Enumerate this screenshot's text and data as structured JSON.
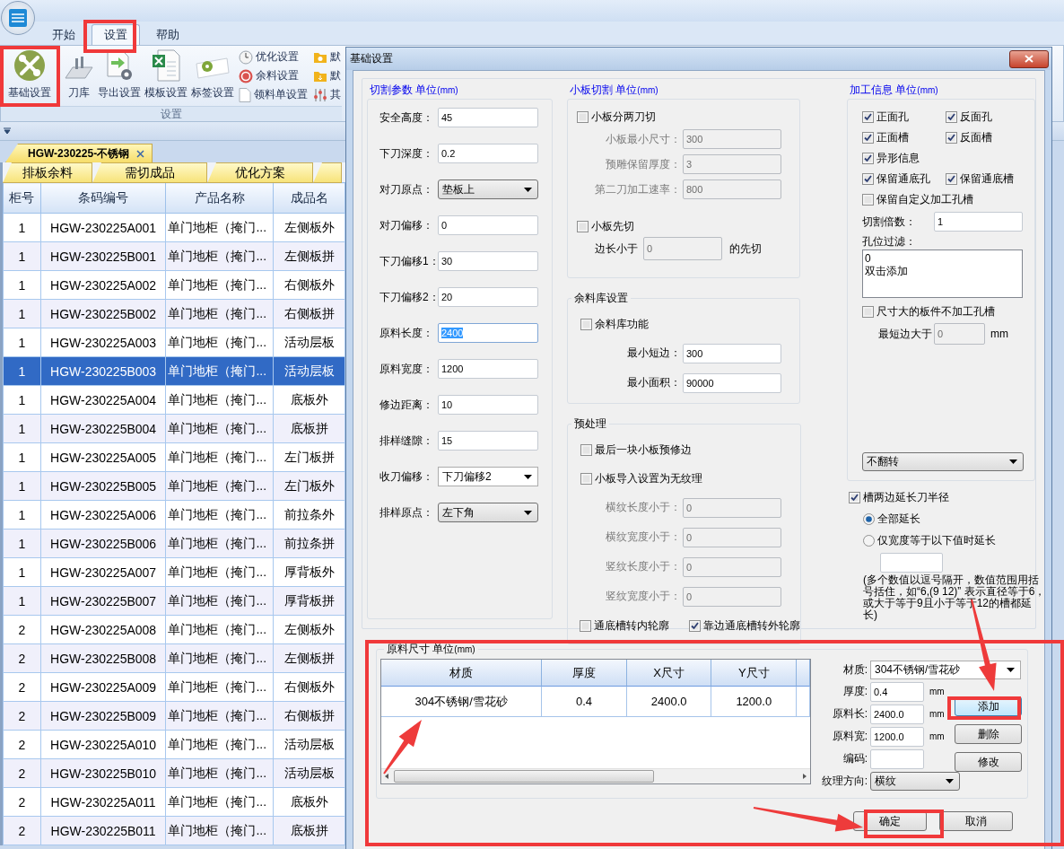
{
  "app": {
    "ribbon_tabs": [
      {
        "label": "开始",
        "selected": false
      },
      {
        "label": "设置",
        "selected": true
      },
      {
        "label": "帮助",
        "selected": false
      }
    ],
    "ribbon_large_buttons": [
      "基础设置",
      "刀库",
      "导出设置",
      "模板设置",
      "标签设置"
    ],
    "ribbon_small_buttons": [
      "优化设置",
      "余料设置",
      "领料单设置",
      "默",
      "默",
      "其"
    ],
    "ribbon_group_label": "设置",
    "document_tab": "HGW-230225-不锈钢",
    "sub_tabs": [
      "排板余料",
      "需切成品",
      "优化方案"
    ],
    "table": {
      "columns": [
        "柜号",
        "条码编号",
        "产品名称",
        "成品名"
      ],
      "rows": [
        {
          "cells": [
            "1",
            "HGW-230225A001",
            "单门地柜（掩门...",
            "左侧板外"
          ],
          "selected": false
        },
        {
          "cells": [
            "1",
            "HGW-230225B001",
            "单门地柜（掩门...",
            "左侧板拼"
          ],
          "selected": false
        },
        {
          "cells": [
            "1",
            "HGW-230225A002",
            "单门地柜（掩门...",
            "右侧板外"
          ],
          "selected": false
        },
        {
          "cells": [
            "1",
            "HGW-230225B002",
            "单门地柜（掩门...",
            "右侧板拼"
          ],
          "selected": false
        },
        {
          "cells": [
            "1",
            "HGW-230225A003",
            "单门地柜（掩门...",
            "活动层板"
          ],
          "selected": false
        },
        {
          "cells": [
            "1",
            "HGW-230225B003",
            "单门地柜（掩门...",
            "活动层板"
          ],
          "selected": true
        },
        {
          "cells": [
            "1",
            "HGW-230225A004",
            "单门地柜（掩门...",
            "底板外"
          ],
          "selected": false
        },
        {
          "cells": [
            "1",
            "HGW-230225B004",
            "单门地柜（掩门...",
            "底板拼"
          ],
          "selected": false
        },
        {
          "cells": [
            "1",
            "HGW-230225A005",
            "单门地柜（掩门...",
            "左门板拼"
          ],
          "selected": false
        },
        {
          "cells": [
            "1",
            "HGW-230225B005",
            "单门地柜（掩门...",
            "左门板外"
          ],
          "selected": false
        },
        {
          "cells": [
            "1",
            "HGW-230225A006",
            "单门地柜（掩门...",
            "前拉条外"
          ],
          "selected": false
        },
        {
          "cells": [
            "1",
            "HGW-230225B006",
            "单门地柜（掩门...",
            "前拉条拼"
          ],
          "selected": false
        },
        {
          "cells": [
            "1",
            "HGW-230225A007",
            "单门地柜（掩门...",
            "厚背板外"
          ],
          "selected": false
        },
        {
          "cells": [
            "1",
            "HGW-230225B007",
            "单门地柜（掩门...",
            "厚背板拼"
          ],
          "selected": false
        },
        {
          "cells": [
            "2",
            "HGW-230225A008",
            "单门地柜（掩门...",
            "左侧板外"
          ],
          "selected": false
        },
        {
          "cells": [
            "2",
            "HGW-230225B008",
            "单门地柜（掩门...",
            "左侧板拼"
          ],
          "selected": false
        },
        {
          "cells": [
            "2",
            "HGW-230225A009",
            "单门地柜（掩门...",
            "右侧板外"
          ],
          "selected": false
        },
        {
          "cells": [
            "2",
            "HGW-230225B009",
            "单门地柜（掩门...",
            "右侧板拼"
          ],
          "selected": false
        },
        {
          "cells": [
            "2",
            "HGW-230225A010",
            "单门地柜（掩门...",
            "活动层板"
          ],
          "selected": false
        },
        {
          "cells": [
            "2",
            "HGW-230225B010",
            "单门地柜（掩门...",
            "活动层板"
          ],
          "selected": false
        },
        {
          "cells": [
            "2",
            "HGW-230225A011",
            "单门地柜（掩门...",
            "底板外"
          ],
          "selected": false
        },
        {
          "cells": [
            "2",
            "HGW-230225B011",
            "单门地柜（掩门...",
            "底板拼"
          ],
          "selected": false
        }
      ]
    }
  },
  "dialog": {
    "title": "基础设置",
    "cutting": {
      "title": "切割参数 单位",
      "unit": "(mm)",
      "fields": [
        {
          "kind": "input",
          "label": "安全高度：",
          "value": "45",
          "focused": false
        },
        {
          "kind": "input",
          "label": "下刀深度：",
          "value": "0.2",
          "focused": false
        },
        {
          "kind": "select",
          "label": "对刀原点：",
          "value": "垫板上",
          "focused": false
        },
        {
          "kind": "input",
          "label": "对刀偏移：",
          "value": "0",
          "focused": false
        },
        {
          "kind": "input",
          "label": "下刀偏移1：",
          "value": "30",
          "focused": false
        },
        {
          "kind": "input",
          "label": "下刀偏移2：",
          "value": "20",
          "focused": false
        },
        {
          "kind": "input",
          "label": "原料长度：",
          "value": "2400",
          "focused": true
        },
        {
          "kind": "input",
          "label": "原料宽度：",
          "value": "1200",
          "focused": false
        },
        {
          "kind": "input",
          "label": "修边距离：",
          "value": "10",
          "focused": false
        },
        {
          "kind": "input",
          "label": "排样缝隙：",
          "value": "15",
          "focused": false
        },
        {
          "kind": "combo",
          "label": "收刀偏移：",
          "value": "下刀偏移2",
          "focused": false
        },
        {
          "kind": "select",
          "label": "排样原点：",
          "value": "左下角",
          "focused": false
        }
      ]
    },
    "small_cut": {
      "title": "小板切割 单位",
      "unit": "(mm)",
      "items": [
        {
          "kind": "checkbox",
          "label": "小板分两刀切",
          "checked": false
        },
        {
          "kind": "field",
          "label": "小板最小尺寸：",
          "value": "300",
          "disabled": true
        },
        {
          "kind": "field",
          "label": "预雕保留厚度：",
          "value": "3",
          "disabled": true
        },
        {
          "kind": "field",
          "label": "第二刀加工速率：",
          "value": "800",
          "disabled": true
        },
        {
          "kind": "checkbox",
          "label": "小板先切",
          "checked": false
        },
        {
          "kind": "inline",
          "label": "边长小于",
          "value": "0",
          "suffix": "的先切",
          "disabled": true
        }
      ]
    },
    "remnant": {
      "title": "余料库设置",
      "items": [
        {
          "kind": "checkbox",
          "label": "余料库功能",
          "checked": false
        },
        {
          "kind": "field",
          "label": "最小短边：",
          "value": "300",
          "disabled": false
        },
        {
          "kind": "field",
          "label": "最小面积：",
          "value": "90000",
          "disabled": false
        }
      ]
    },
    "preprocess": {
      "title": "预处理",
      "items": [
        {
          "kind": "checkbox",
          "label": "最后一块小板预修边",
          "checked": false
        },
        {
          "kind": "checkbox",
          "label": "小板导入设置为无纹理",
          "checked": false
        },
        {
          "kind": "field",
          "label": "横纹长度小于：",
          "value": "0",
          "disabled": true
        },
        {
          "kind": "field",
          "label": "横纹宽度小于：",
          "value": "0",
          "disabled": true
        },
        {
          "kind": "field",
          "label": "竖纹长度小于：",
          "value": "0",
          "disabled": true
        },
        {
          "kind": "field",
          "label": "竖纹宽度小于：",
          "value": "0",
          "disabled": true
        },
        {
          "kind": "pair",
          "items": [
            {
              "label": "通底槽转内轮廓",
              "checked": false
            },
            {
              "label": "靠边通底槽转外轮廓",
              "checked": true
            }
          ]
        }
      ]
    },
    "machining": {
      "title": "加工信息 单位",
      "unit": "(mm)",
      "items": [
        {
          "kind": "pair",
          "items": [
            {
              "label": "正面孔",
              "checked": true
            },
            {
              "label": "反面孔",
              "checked": true
            }
          ]
        },
        {
          "kind": "pair",
          "items": [
            {
              "label": "正面槽",
              "checked": true
            },
            {
              "label": "反面槽",
              "checked": true
            }
          ]
        },
        {
          "kind": "checkbox",
          "label": "异形信息",
          "checked": true
        },
        {
          "kind": "pair",
          "items": [
            {
              "label": "保留通底孔",
              "checked": true
            },
            {
              "label": "保留通底槽",
              "checked": true
            }
          ]
        },
        {
          "kind": "checkbox",
          "label": "保留自定义加工孔槽",
          "checked": false
        },
        {
          "kind": "field",
          "label": "切割倍数：",
          "value": "1",
          "disabled": false
        },
        {
          "kind": "label",
          "label": "孔位过滤："
        },
        {
          "kind": "textarea",
          "lines": [
            "0",
            "双击添加"
          ]
        },
        {
          "kind": "checkbox",
          "label": "尺寸大的板件不加工孔槽",
          "checked": false
        },
        {
          "kind": "inline",
          "label": "最短边大于",
          "value": "0",
          "suffix": "mm",
          "disabled": true
        },
        {
          "kind": "select",
          "value": "不翻转"
        }
      ]
    },
    "extend": {
      "checkbox": {
        "label": "槽两边延长刀半径",
        "checked": true
      },
      "options": [
        {
          "label": "全部延长",
          "selected": true
        },
        {
          "label": "仅宽度等于以下值时延长",
          "selected": false
        }
      ],
      "note": "(多个数值以逗号隔开，数值范围用括号括住，如“6,(9 12)” 表示直径等于6，或大于等于9且小于等于12的槽都延长)"
    },
    "material": {
      "title": "原料尺寸 单位",
      "unit": "(mm)",
      "columns": [
        "材质",
        "厚度",
        "X尺寸",
        "Y尺寸"
      ],
      "rows": [
        [
          "304不锈钢/雪花砂",
          "0.4",
          "2400.0",
          "1200.0"
        ]
      ],
      "form": [
        {
          "kind": "select",
          "label": "材质:",
          "value": "304不锈钢/雪花砂"
        },
        {
          "kind": "input",
          "label": "厚度:",
          "value": "0.4",
          "unit": "mm"
        },
        {
          "kind": "input",
          "label": "原料长:",
          "value": "2400.0",
          "unit": "mm"
        },
        {
          "kind": "input",
          "label": "原料宽:",
          "value": "1200.0",
          "unit": "mm"
        },
        {
          "kind": "input",
          "label": "编码:"
        },
        {
          "kind": "combo",
          "label": "纹理方向:",
          "value": "横纹"
        }
      ],
      "buttons": [
        {
          "label": "添加",
          "default": true
        },
        {
          "label": "删除",
          "default": false
        },
        {
          "label": "修改",
          "default": false
        }
      ]
    },
    "footer_buttons": [
      "确定",
      "取消"
    ]
  }
}
